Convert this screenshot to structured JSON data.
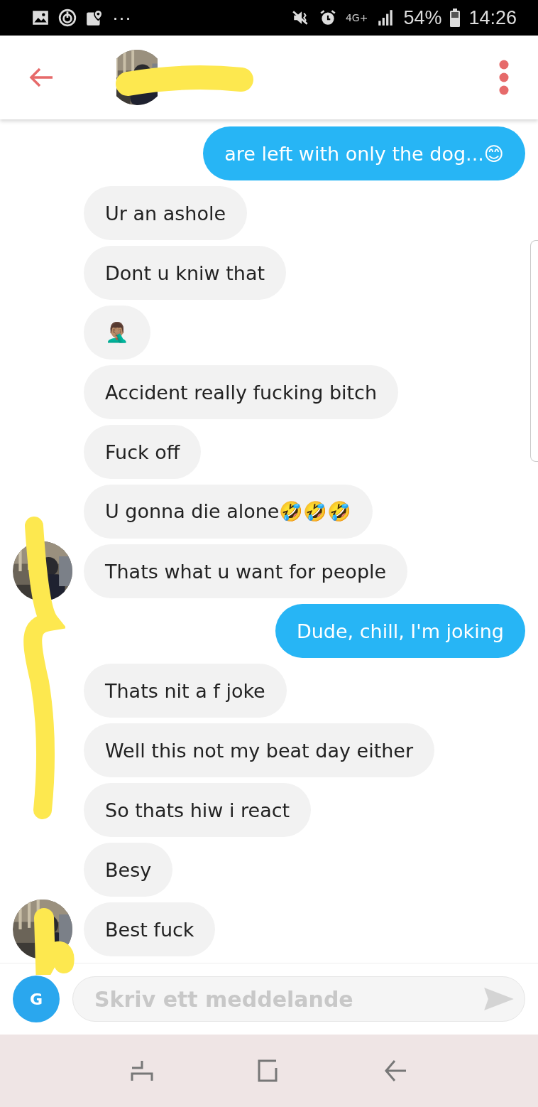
{
  "status_bar": {
    "more": "···",
    "network": "4G+",
    "battery": "54%",
    "time": "14:26"
  },
  "messages": [
    {
      "outgoing": true,
      "text": "are left with only the dog...😊",
      "avatar": false
    },
    {
      "outgoing": false,
      "text": "Ur an ashole",
      "avatar": false
    },
    {
      "outgoing": false,
      "text": "Dont u kniw that",
      "avatar": false
    },
    {
      "outgoing": false,
      "text": "🤦🏽‍♂️",
      "avatar": false
    },
    {
      "outgoing": false,
      "text": "Accident really fucking bitch",
      "avatar": false
    },
    {
      "outgoing": false,
      "text": "Fuck off",
      "avatar": false
    },
    {
      "outgoing": false,
      "text": "U gonna die alone🤣🤣🤣",
      "avatar": false
    },
    {
      "outgoing": false,
      "text": "Thats what u want for people",
      "avatar": true
    },
    {
      "outgoing": true,
      "text": "Dude, chill, I'm joking",
      "avatar": false
    },
    {
      "outgoing": false,
      "text": "Thats nit a f joke",
      "avatar": false
    },
    {
      "outgoing": false,
      "text": "Well this not my beat day either",
      "avatar": false
    },
    {
      "outgoing": false,
      "text": "So thats hiw i react",
      "avatar": false
    },
    {
      "outgoing": false,
      "text": "Besy",
      "avatar": false
    },
    {
      "outgoing": false,
      "text": "Best fuck",
      "avatar": true
    }
  ],
  "composer": {
    "user_initial": "G",
    "placeholder": "Skriv ett meddelande"
  }
}
